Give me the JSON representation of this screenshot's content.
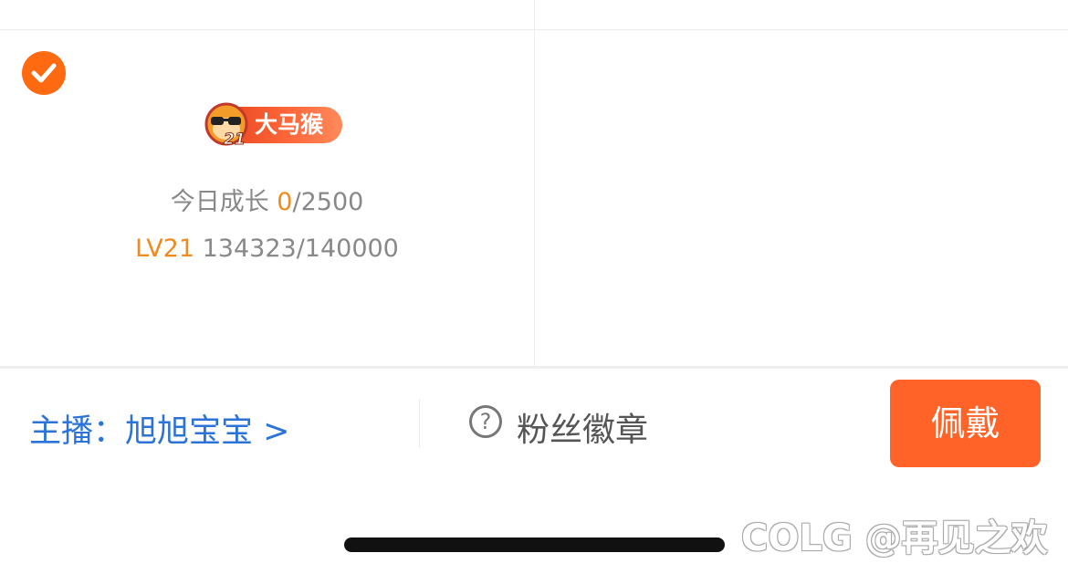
{
  "card": {
    "selected": true,
    "badge": {
      "label": "大马猴",
      "level_number": "21"
    },
    "growth": {
      "label": "今日成长",
      "current": "0",
      "total": "/2500"
    },
    "level": {
      "label": "LV21",
      "progress": "134323/140000"
    }
  },
  "bottom_bar": {
    "anchor": "主播：旭旭宝宝 >",
    "help_icon": "?",
    "title": "粉丝徽章",
    "wear_button": "佩戴"
  },
  "watermark": "COLG @再见之欢",
  "colors": {
    "accent_orange": "#ff6a10",
    "link_blue": "#2b73d6",
    "button_orange": "#ff6328"
  },
  "icons": {
    "check": "check-icon",
    "badge_avatar": "monkey-icon",
    "help": "question-circle-icon"
  }
}
